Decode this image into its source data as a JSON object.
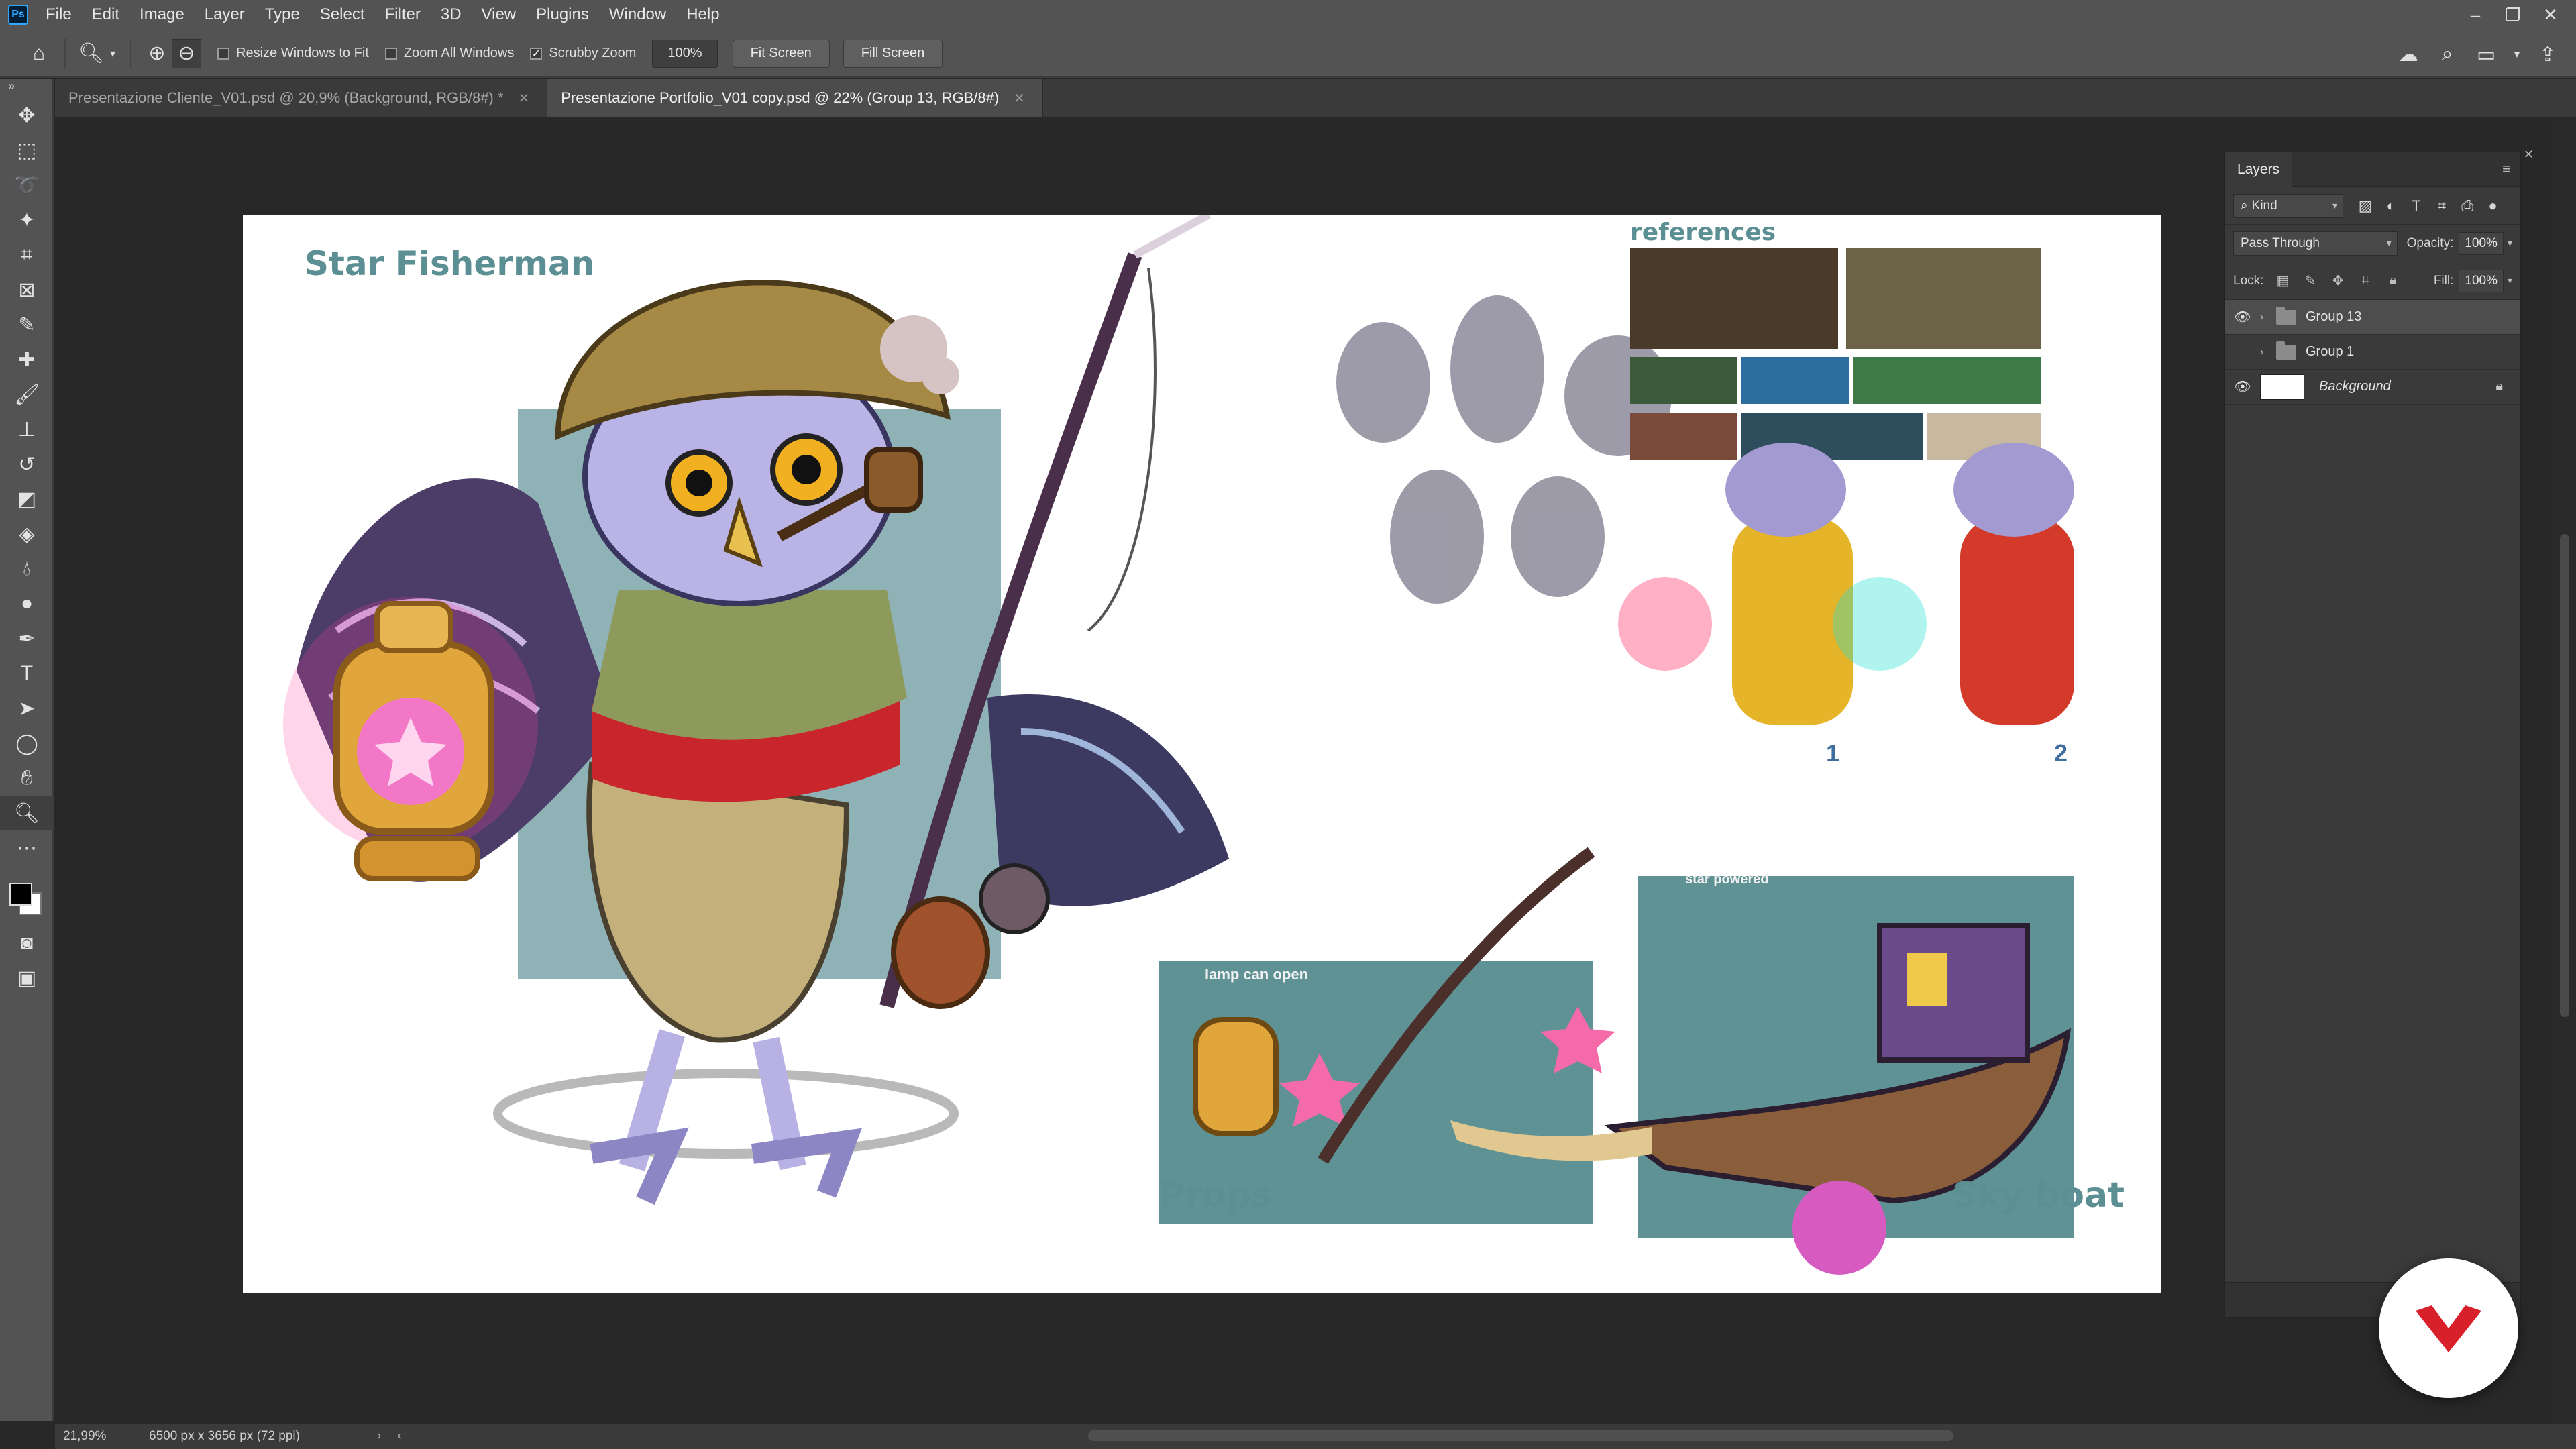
{
  "app": {
    "logo": "Ps",
    "menu": [
      "File",
      "Edit",
      "Image",
      "Layer",
      "Type",
      "Select",
      "Filter",
      "3D",
      "View",
      "Plugins",
      "Window",
      "Help"
    ]
  },
  "options": {
    "resize_windows": "Resize Windows to Fit",
    "zoom_all": "Zoom All Windows",
    "scrubby_zoom": "Scrubby Zoom",
    "zoom_value": "100%",
    "fit_screen": "Fit Screen",
    "fill_screen": "Fill Screen"
  },
  "tabs": [
    {
      "label": "Presentazione Cliente_V01.psd @ 20,9% (Background, RGB/8#) *"
    },
    {
      "label": "Presentazione Portfolio_V01 copy.psd @ 22% (Group 13, RGB/8#)"
    }
  ],
  "document": {
    "title": "Star Fisherman",
    "references": "references",
    "props": "Props",
    "sky_boat": "Sky boat",
    "lamp_note": "lamp can open",
    "star_note": "star powered",
    "variant_1": "1",
    "variant_2": "2"
  },
  "layers_panel": {
    "title": "Layers",
    "filter": "Kind",
    "blend_mode": "Pass Through",
    "opacity_label": "Opacity:",
    "opacity_value": "100%",
    "lock_label": "Lock:",
    "fill_label": "Fill:",
    "fill_value": "100%",
    "layers": [
      {
        "name": "Group 13",
        "visible": true
      },
      {
        "name": "Group 1",
        "visible": false
      },
      {
        "name": "Background",
        "visible": true
      }
    ]
  },
  "status": {
    "zoom": "21,99%",
    "dimensions": "6500 px x 3656 px (72 ppi)"
  },
  "colors": {
    "accent_teal": "#5b8f93",
    "panel_teal": "#5f9295",
    "brand_red": "#d8202a"
  }
}
